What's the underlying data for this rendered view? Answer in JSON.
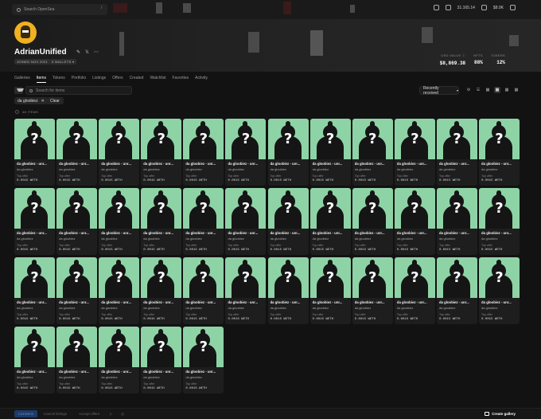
{
  "topbar": {
    "search_placeholder": "Search OpenSea",
    "slash": "/",
    "balance_1": "31.165.14",
    "balance_2": "$8.9K"
  },
  "profile": {
    "name": "AdrianUnified",
    "joined": "JOINED NOV 2021",
    "wallets": "5 WALLETS ▾",
    "stats": [
      {
        "label": "USD VALUE ⓘ",
        "value": "$8,869.38"
      },
      {
        "label": "NFTS",
        "value": "88%"
      },
      {
        "label": "TOKENS",
        "value": "12%"
      }
    ]
  },
  "tabs": [
    "Galleries",
    "Items",
    "Tokens",
    "Portfolio",
    "Listings",
    "Offers",
    "Created",
    "Watchlist",
    "Favorites",
    "Activity"
  ],
  "active_tab": "Items",
  "toolbar": {
    "search_placeholder": "Search for items",
    "sort_label": "Recently received"
  },
  "filter": {
    "chip_label": "da gloobiez",
    "clear_label": "Clear",
    "count_label": "46 ITEMS"
  },
  "item_template": {
    "title": "da gloobiez - unr...",
    "collection": "da gloobiez",
    "offer_label": "Top offer",
    "offer_value": "0.0015 WETH"
  },
  "item_count": 41,
  "colors": {
    "card_image_bg": "#8ed3a6",
    "accent_blue": "#1d3a6a"
  },
  "bottombar": {
    "list_label": "List items",
    "cancel_label": "Cancel listings",
    "accept_label": "Accept offers",
    "create_label": "Create gallery"
  }
}
